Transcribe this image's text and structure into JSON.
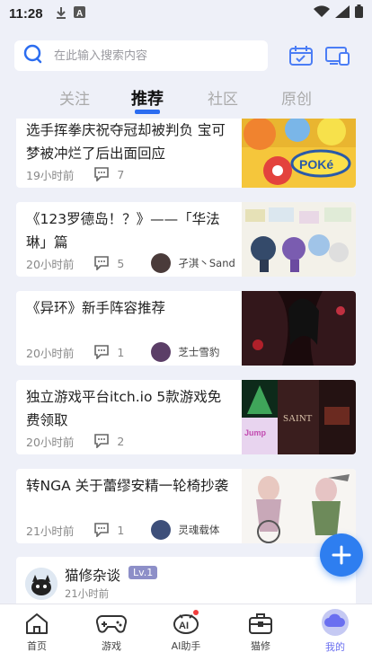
{
  "status_bar": {
    "time": "11:28",
    "icons": [
      "download-icon",
      "a-box-icon",
      "wifi-icon",
      "signal-icon",
      "battery-icon"
    ]
  },
  "search": {
    "placeholder": "在此输入搜索内容"
  },
  "tabs": [
    {
      "label": "关注",
      "active": false
    },
    {
      "label": "推荐",
      "active": true
    },
    {
      "label": "社区",
      "active": false
    },
    {
      "label": "原创",
      "active": false
    }
  ],
  "feed": [
    {
      "title": "选手挥拳庆祝夺冠却被判负 宝可梦被冲烂了后出面回应",
      "time": "19小时前",
      "comments": "7",
      "user": ""
    },
    {
      "title": "《123罗德岛！？》——「华法琳」篇",
      "time": "20小时前",
      "comments": "5",
      "user": "孑淇丶Sand"
    },
    {
      "title": "《异环》新手阵容推荐",
      "time": "20小时前",
      "comments": "1",
      "user": "芝士雪豹"
    },
    {
      "title": "独立游戏平台itch.io 5款游戏免费领取",
      "time": "20小时前",
      "comments": "2",
      "user": ""
    },
    {
      "title": "转NGA 关于蕾缪安精一轮椅抄袭",
      "time": "21小时前",
      "comments": "1",
      "user": "灵魂载体"
    }
  ],
  "forum": {
    "name": "猫修杂谈",
    "level": "Lv.1",
    "time": "21小时前"
  },
  "bottom_nav": [
    {
      "label": "首页",
      "icon": "home-icon"
    },
    {
      "label": "游戏",
      "icon": "gamepad-icon"
    },
    {
      "label": "AI助手",
      "icon": "ai-assistant-icon"
    },
    {
      "label": "猫修",
      "icon": "toolbox-icon"
    },
    {
      "label": "我的",
      "icon": "profile-icon"
    }
  ],
  "colors": {
    "accent": "#2c6df0",
    "fab": "#2e7ef0",
    "background": "#eef0f8",
    "nav_active": "#6a6ff0"
  }
}
